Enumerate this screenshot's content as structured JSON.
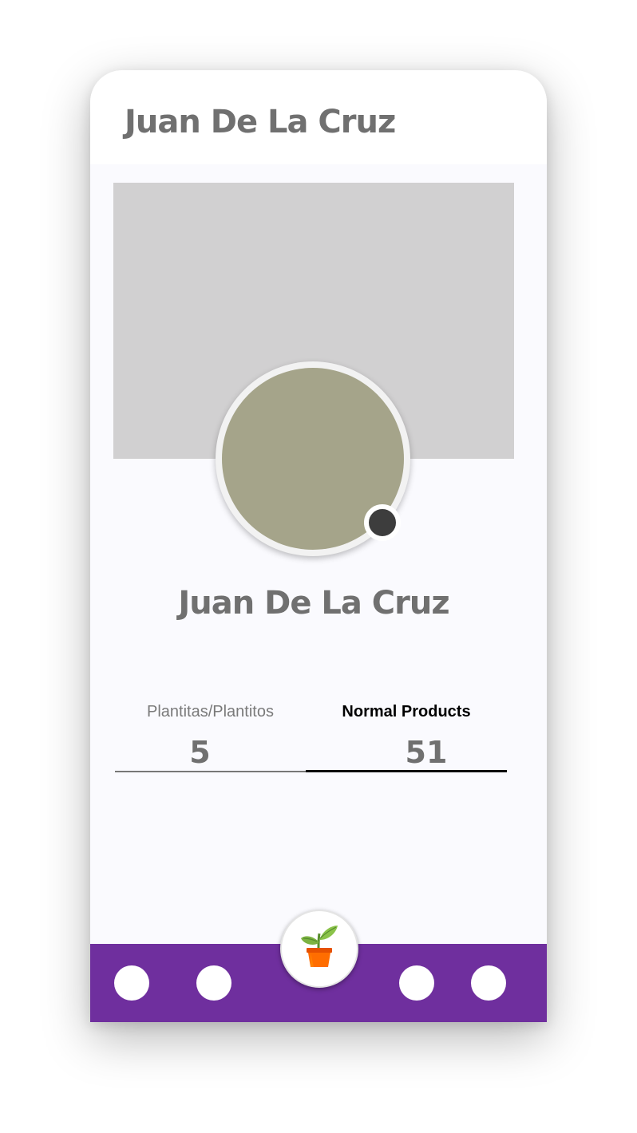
{
  "header": {
    "title": "Juan De La Cruz"
  },
  "profile": {
    "name": "Juan De La Cruz",
    "online_status_color": "#3d3d3d"
  },
  "tabs": [
    {
      "label": "Plantitas/Plantitos",
      "count": "5",
      "selected": false
    },
    {
      "label": "Normal Products",
      "count": "51",
      "selected": true
    }
  ],
  "bottom_nav": {
    "background_color": "#6f2f9e",
    "items": [
      "nav-dot",
      "nav-dot",
      "nav-dot",
      "nav-dot"
    ],
    "fab_icon": "potted-plant-icon"
  },
  "colors": {
    "cover": "#d1d0d1",
    "avatar": "#a5a48a",
    "text_gray": "#707070"
  }
}
